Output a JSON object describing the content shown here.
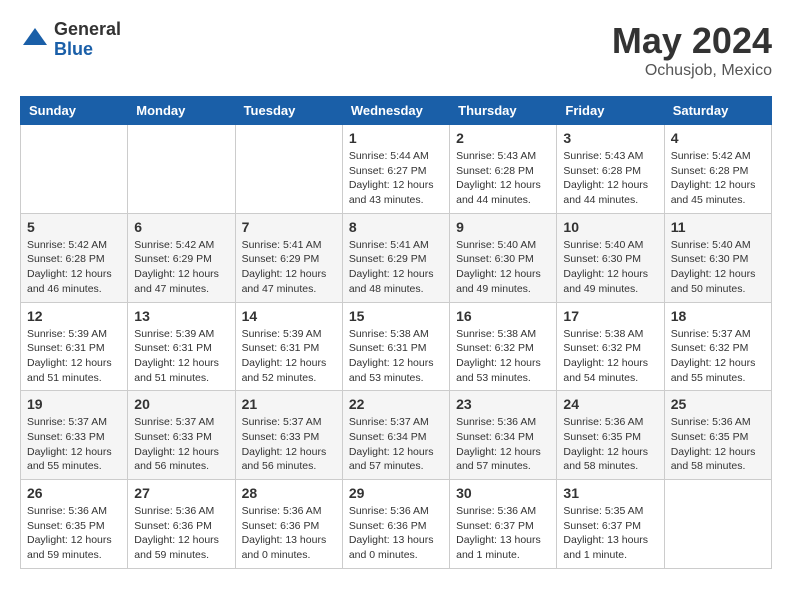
{
  "logo": {
    "general": "General",
    "blue": "Blue"
  },
  "header": {
    "month": "May 2024",
    "location": "Ochusjob, Mexico"
  },
  "weekdays": [
    "Sunday",
    "Monday",
    "Tuesday",
    "Wednesday",
    "Thursday",
    "Friday",
    "Saturday"
  ],
  "weeks": [
    [
      {
        "day": "",
        "info": ""
      },
      {
        "day": "",
        "info": ""
      },
      {
        "day": "",
        "info": ""
      },
      {
        "day": "1",
        "info": "Sunrise: 5:44 AM\nSunset: 6:27 PM\nDaylight: 12 hours\nand 43 minutes."
      },
      {
        "day": "2",
        "info": "Sunrise: 5:43 AM\nSunset: 6:28 PM\nDaylight: 12 hours\nand 44 minutes."
      },
      {
        "day": "3",
        "info": "Sunrise: 5:43 AM\nSunset: 6:28 PM\nDaylight: 12 hours\nand 44 minutes."
      },
      {
        "day": "4",
        "info": "Sunrise: 5:42 AM\nSunset: 6:28 PM\nDaylight: 12 hours\nand 45 minutes."
      }
    ],
    [
      {
        "day": "5",
        "info": "Sunrise: 5:42 AM\nSunset: 6:28 PM\nDaylight: 12 hours\nand 46 minutes."
      },
      {
        "day": "6",
        "info": "Sunrise: 5:42 AM\nSunset: 6:29 PM\nDaylight: 12 hours\nand 47 minutes."
      },
      {
        "day": "7",
        "info": "Sunrise: 5:41 AM\nSunset: 6:29 PM\nDaylight: 12 hours\nand 47 minutes."
      },
      {
        "day": "8",
        "info": "Sunrise: 5:41 AM\nSunset: 6:29 PM\nDaylight: 12 hours\nand 48 minutes."
      },
      {
        "day": "9",
        "info": "Sunrise: 5:40 AM\nSunset: 6:30 PM\nDaylight: 12 hours\nand 49 minutes."
      },
      {
        "day": "10",
        "info": "Sunrise: 5:40 AM\nSunset: 6:30 PM\nDaylight: 12 hours\nand 49 minutes."
      },
      {
        "day": "11",
        "info": "Sunrise: 5:40 AM\nSunset: 6:30 PM\nDaylight: 12 hours\nand 50 minutes."
      }
    ],
    [
      {
        "day": "12",
        "info": "Sunrise: 5:39 AM\nSunset: 6:31 PM\nDaylight: 12 hours\nand 51 minutes."
      },
      {
        "day": "13",
        "info": "Sunrise: 5:39 AM\nSunset: 6:31 PM\nDaylight: 12 hours\nand 51 minutes."
      },
      {
        "day": "14",
        "info": "Sunrise: 5:39 AM\nSunset: 6:31 PM\nDaylight: 12 hours\nand 52 minutes."
      },
      {
        "day": "15",
        "info": "Sunrise: 5:38 AM\nSunset: 6:31 PM\nDaylight: 12 hours\nand 53 minutes."
      },
      {
        "day": "16",
        "info": "Sunrise: 5:38 AM\nSunset: 6:32 PM\nDaylight: 12 hours\nand 53 minutes."
      },
      {
        "day": "17",
        "info": "Sunrise: 5:38 AM\nSunset: 6:32 PM\nDaylight: 12 hours\nand 54 minutes."
      },
      {
        "day": "18",
        "info": "Sunrise: 5:37 AM\nSunset: 6:32 PM\nDaylight: 12 hours\nand 55 minutes."
      }
    ],
    [
      {
        "day": "19",
        "info": "Sunrise: 5:37 AM\nSunset: 6:33 PM\nDaylight: 12 hours\nand 55 minutes."
      },
      {
        "day": "20",
        "info": "Sunrise: 5:37 AM\nSunset: 6:33 PM\nDaylight: 12 hours\nand 56 minutes."
      },
      {
        "day": "21",
        "info": "Sunrise: 5:37 AM\nSunset: 6:33 PM\nDaylight: 12 hours\nand 56 minutes."
      },
      {
        "day": "22",
        "info": "Sunrise: 5:37 AM\nSunset: 6:34 PM\nDaylight: 12 hours\nand 57 minutes."
      },
      {
        "day": "23",
        "info": "Sunrise: 5:36 AM\nSunset: 6:34 PM\nDaylight: 12 hours\nand 57 minutes."
      },
      {
        "day": "24",
        "info": "Sunrise: 5:36 AM\nSunset: 6:35 PM\nDaylight: 12 hours\nand 58 minutes."
      },
      {
        "day": "25",
        "info": "Sunrise: 5:36 AM\nSunset: 6:35 PM\nDaylight: 12 hours\nand 58 minutes."
      }
    ],
    [
      {
        "day": "26",
        "info": "Sunrise: 5:36 AM\nSunset: 6:35 PM\nDaylight: 12 hours\nand 59 minutes."
      },
      {
        "day": "27",
        "info": "Sunrise: 5:36 AM\nSunset: 6:36 PM\nDaylight: 12 hours\nand 59 minutes."
      },
      {
        "day": "28",
        "info": "Sunrise: 5:36 AM\nSunset: 6:36 PM\nDaylight: 13 hours\nand 0 minutes."
      },
      {
        "day": "29",
        "info": "Sunrise: 5:36 AM\nSunset: 6:36 PM\nDaylight: 13 hours\nand 0 minutes."
      },
      {
        "day": "30",
        "info": "Sunrise: 5:36 AM\nSunset: 6:37 PM\nDaylight: 13 hours\nand 1 minute."
      },
      {
        "day": "31",
        "info": "Sunrise: 5:35 AM\nSunset: 6:37 PM\nDaylight: 13 hours\nand 1 minute."
      },
      {
        "day": "",
        "info": ""
      }
    ]
  ]
}
